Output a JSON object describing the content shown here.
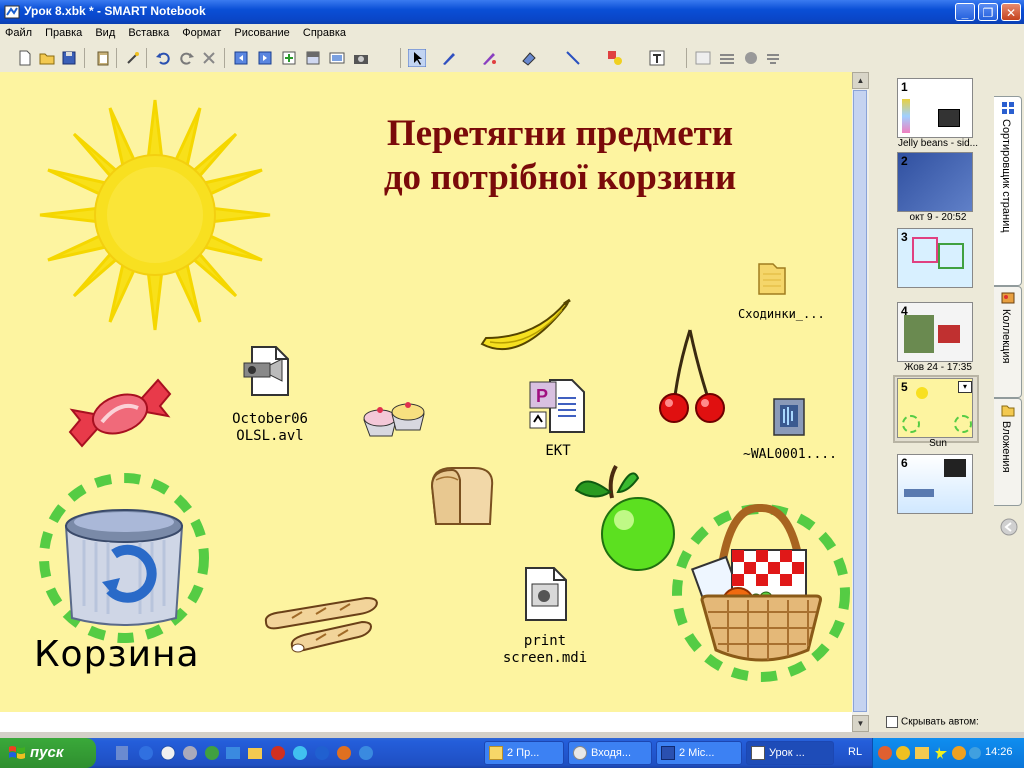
{
  "window": {
    "title": "Урок 8.xbk * - SMART Notebook",
    "min_glyph": "_",
    "max_glyph": "❐",
    "close_glyph": "✕"
  },
  "menu": [
    "Файл",
    "Правка",
    "Вид",
    "Вставка",
    "Формат",
    "Рисование",
    "Справка"
  ],
  "slide": {
    "title_line1": "Перетягни предмети",
    "title_line2": "до потрібної корзини",
    "files": {
      "october": [
        "October06",
        "OLSL.avl"
      ],
      "ekt": "EKT",
      "shodinki": "Сходинки_...",
      "wal": "~WAL0001....",
      "print": [
        "print",
        "screen.mdi"
      ]
    },
    "korzina_label": "Корзина"
  },
  "pages": [
    {
      "num": "1",
      "caption": "Jelly beans - sid..."
    },
    {
      "num": "2",
      "caption": "окт 9 - 20:52"
    },
    {
      "num": "3",
      "caption": ""
    },
    {
      "num": "4",
      "caption": "Жов 24 - 17:35"
    },
    {
      "num": "5",
      "caption": "Sun"
    },
    {
      "num": "6",
      "caption": ""
    }
  ],
  "side_tabs": [
    "Сортировщик страниц",
    "Коллекция",
    "Вложения"
  ],
  "hide_auto_label": "Скрывать автом:",
  "taskbar": {
    "start_label": "пуск",
    "tasks": [
      {
        "label": "2 Пр..."
      },
      {
        "label": "Входя..."
      },
      {
        "label": "2 Mic..."
      },
      {
        "label": "Урок ..."
      }
    ],
    "lang": "RL",
    "clock": "14:26"
  },
  "colors": {
    "canvas_bg": "#fdf4a0",
    "title_color": "#7a0a0a",
    "dash_ring": "#55cc44",
    "xp_blue": "#0a4fd6"
  }
}
